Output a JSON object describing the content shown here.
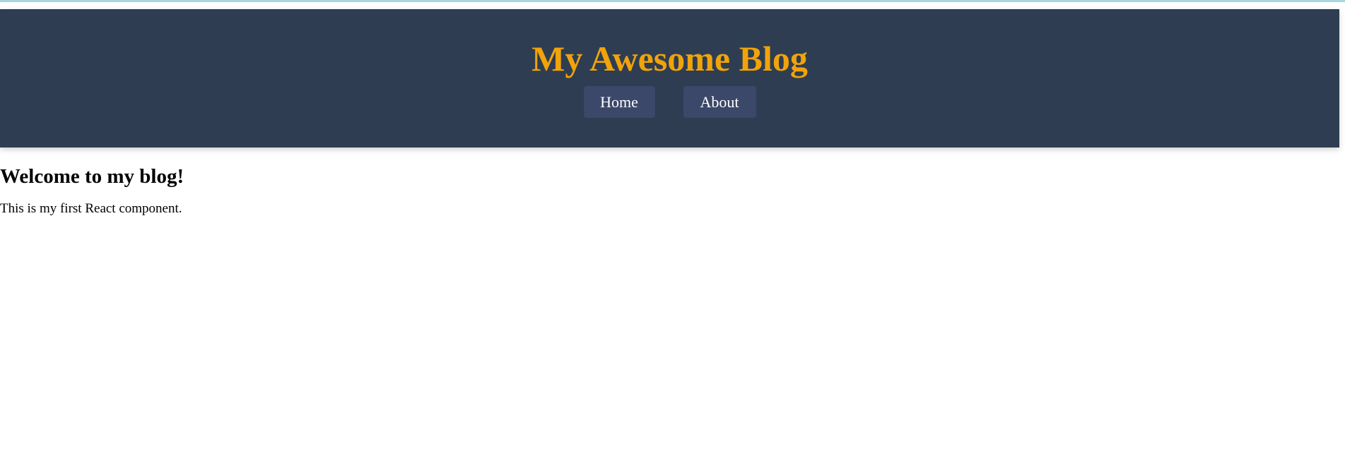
{
  "header": {
    "title": "My Awesome Blog",
    "nav": [
      {
        "label": "Home"
      },
      {
        "label": "About"
      }
    ]
  },
  "main": {
    "heading": "Welcome to my blog!",
    "text": "This is my first React component."
  },
  "colors": {
    "header_bg": "#2e3d51",
    "title": "#f0a30a",
    "nav_button_bg": "#3b4869",
    "nav_button_text": "#ffffff"
  }
}
